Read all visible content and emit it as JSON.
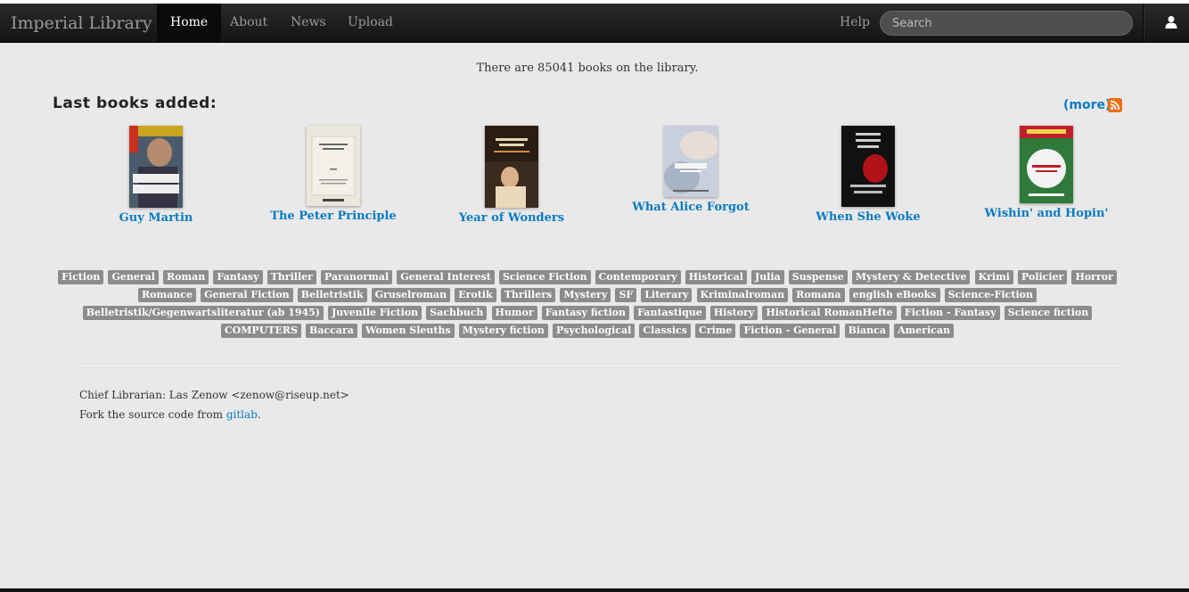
{
  "nav": {
    "brand": "Imperial Library",
    "items": [
      {
        "label": "Home",
        "active": true
      },
      {
        "label": "About"
      },
      {
        "label": "News"
      },
      {
        "label": "Upload"
      }
    ],
    "help": "Help",
    "search_placeholder": "Search",
    "user_icon": "user-icon"
  },
  "main": {
    "count_text": "There are 85041 books on the library.",
    "last_books_heading": "Last books added:",
    "more_label": "more",
    "rss_icon": "rss-icon",
    "books": [
      {
        "title": "Guy Martin",
        "cover_bg": "#3a4a5a"
      },
      {
        "title": "The Peter Principle",
        "cover_bg": "#e9e6dc"
      },
      {
        "title": "Year of Wonders",
        "cover_bg": "#3b2a1e"
      },
      {
        "title": "What Alice Forgot",
        "cover_bg": "#b8bfd0"
      },
      {
        "title": "When She Woke",
        "cover_bg": "#1a1a1a"
      },
      {
        "title": "Wishin' and Hopin'",
        "cover_bg": "#2f7a3a"
      }
    ],
    "tags": [
      "Fiction",
      "General",
      "Roman",
      "Fantasy",
      "Thriller",
      "Paranormal",
      "General Interest",
      "Science Fiction",
      "Contemporary",
      "Historical",
      "Julia",
      "Suspense",
      "Mystery & Detective",
      "Krimi",
      "Policier",
      "Horror",
      "Romance",
      "General Fiction",
      "Belletristik",
      "Gruselroman",
      "Erotik",
      "Thrillers",
      "Mystery",
      "SF",
      "Literary",
      "Kriminalroman",
      "Romana",
      "english eBooks",
      "Science-Fiction",
      "Belletristik/Gegenwartsliteratur (ab 1945)",
      "Juvenile Fiction",
      "Sachbuch",
      "Humor",
      "Fantasy fiction",
      "Fantastique",
      "History",
      "Historical RomanHefte",
      "Fiction - Fantasy",
      "Science fiction",
      "COMPUTERS",
      "Baccara",
      "Women Sleuths",
      "Mystery fiction",
      "Psychological",
      "Classics",
      "Crime",
      "Fiction - General",
      "Bianca",
      "American"
    ]
  },
  "footer": {
    "librarian": "Chief Librarian: Las Zenow <zenow@riseup.net>",
    "fork_prefix": "Fork the source code from ",
    "fork_link": "gitlab",
    "fork_suffix": "."
  },
  "colors": {
    "link": "#0a7bc4",
    "tag_bg": "#8c8c8c",
    "navbar": "#1b1b1b"
  }
}
